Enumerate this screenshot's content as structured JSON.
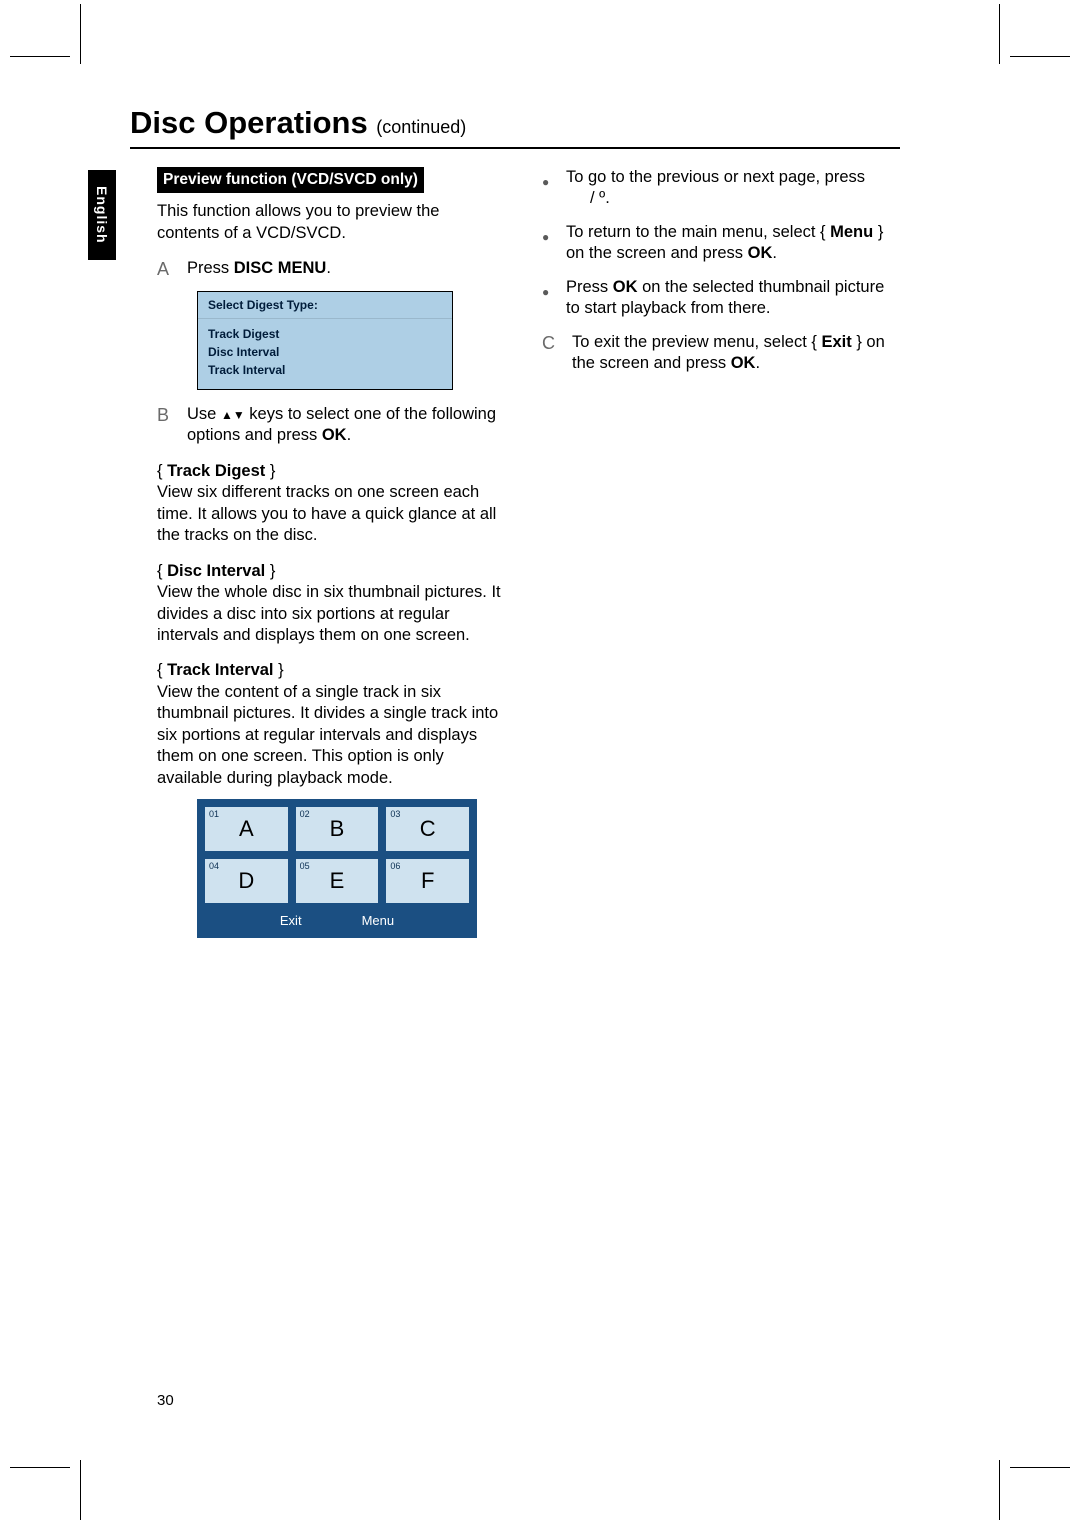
{
  "page_number": "30",
  "language_tab": "English",
  "title": {
    "main": "Disc Operations",
    "sub": "(continued)"
  },
  "left": {
    "header": "Preview function (VCD/SVCD only)",
    "intro": "This function allows you to preview the contents of a VCD/SVCD.",
    "stepA": {
      "label": "A",
      "text_prefix": "Press ",
      "button": "DISC MENU",
      "text_suffix": "."
    },
    "digest_box": {
      "title": "Select Digest Type:",
      "items": [
        "Track Digest",
        "Disc Interval",
        "Track Interval"
      ]
    },
    "stepB": {
      "label": "B",
      "text_prefix": "Use ",
      "text_mid": " keys to select one of the following options and press ",
      "ok": "OK",
      "text_suffix": "."
    },
    "options": [
      {
        "name": "Track Digest",
        "desc": "View six different tracks on one screen each time.  It allows you to have a quick glance at all the tracks on the disc."
      },
      {
        "name": "Disc Interval",
        "desc": "View the whole disc in six thumbnail pictures.  It divides a disc into six portions at regular intervals and displays them on one screen."
      },
      {
        "name": "Track Interval",
        "desc": "View the content of a single track in six thumbnail pictures.  It divides a single track into six portions at regular intervals and displays them on one screen.   This option is only available during playback mode."
      }
    ],
    "thumbs": [
      {
        "num": "01",
        "letter": "A"
      },
      {
        "num": "02",
        "letter": "B"
      },
      {
        "num": "03",
        "letter": "C"
      },
      {
        "num": "04",
        "letter": "D"
      },
      {
        "num": "05",
        "letter": "E"
      },
      {
        "num": "06",
        "letter": "F"
      }
    ],
    "thumb_menu": {
      "exit": "Exit",
      "menu": "Menu"
    }
  },
  "right": {
    "b1": {
      "pre": "To go to the previous or next page, press",
      "suf": "."
    },
    "b2": {
      "pre": "To return to the main menu, select { ",
      "menu": "Menu",
      "mid": " } on the screen and press ",
      "ok": "OK",
      "suf": "."
    },
    "b3": {
      "pre": "Press ",
      "ok": "OK",
      "suf": " on the selected thumbnail picture to start playback from there."
    },
    "stepC": {
      "label": "C",
      "pre": "To exit the preview menu, select { ",
      "exit": "Exit",
      "mid": " } on the screen and press ",
      "ok": "OK",
      "suf": "."
    }
  }
}
